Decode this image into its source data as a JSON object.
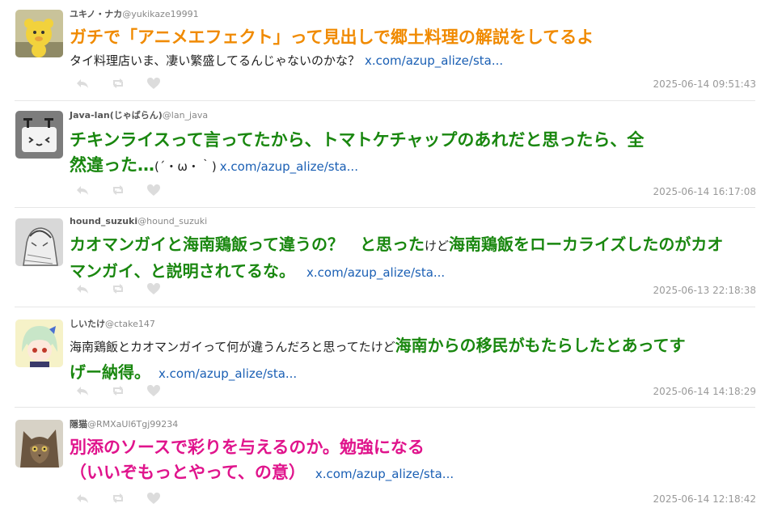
{
  "tweets": [
    {
      "user": "ユキノ・ナカ",
      "handle": "@yukikaze19991",
      "line1": "ガチで「アニメエフェクト」って見出しで郷土料理の解説をしてるよ",
      "line2": "タイ料理店いま、凄い繁盛してるんじゃないのかな？",
      "link": "x.com/azup_alize/sta...",
      "time": "2025-06-14 09:51:43",
      "avatar_icon": "yellow-bear-avatar-icon"
    },
    {
      "user": "Java-lan(じゃばらん)",
      "handle": "@lan_java",
      "line1": "チキンライスって言ってたから、トマトケチャップのあれだと思ったら、全",
      "line2a": "然違った…",
      "line2b": "(´・ω・｀)",
      "link": "x.com/azup_alize/sta...",
      "time": "2025-06-14 16:17:08",
      "avatar_icon": "robot-face-avatar-icon"
    },
    {
      "user": "hound_suzuki",
      "handle": "@hound_suzuki",
      "line1a": "カオマンガイと海南鶏飯って違うの？　と思った",
      "line1b": "けど",
      "line1c": "海南鶏飯をローカライズしたのがカオ",
      "line2": "マンガイ、と説明されてるな。",
      "link": "x.com/azup_alize/sta...",
      "time": "2025-06-13 22:18:38",
      "avatar_icon": "sketch-person-avatar-icon"
    },
    {
      "user": "しいたけ",
      "handle": "@ctake147",
      "line1a": "海南鶏飯とカオマンガイって何が違うんだろと思ってたけど",
      "line1b": "海南からの移民がもたらしたとあってす",
      "line2": "げー納得。",
      "link": "x.com/azup_alize/sta...",
      "time": "2025-06-14 14:18:29",
      "avatar_icon": "anime-girl-avatar-icon"
    },
    {
      "user": "隠猫",
      "handle": "@RMXaUl6Tgj99234",
      "line1": "別添のソースで彩りを与えるのか。勉強になる",
      "line2": "（いいぞもっとやって、の意）",
      "link": "x.com/azup_alize/sta...",
      "time": "2025-06-14 12:18:42",
      "avatar_icon": "cat-photo-avatar-icon"
    }
  ],
  "actions": [
    "reply-icon",
    "retweet-icon",
    "like-icon"
  ],
  "colors": {
    "orange": "#f08a00",
    "green": "#19870f",
    "pink": "#e0148c",
    "link": "#1a5fb4"
  }
}
